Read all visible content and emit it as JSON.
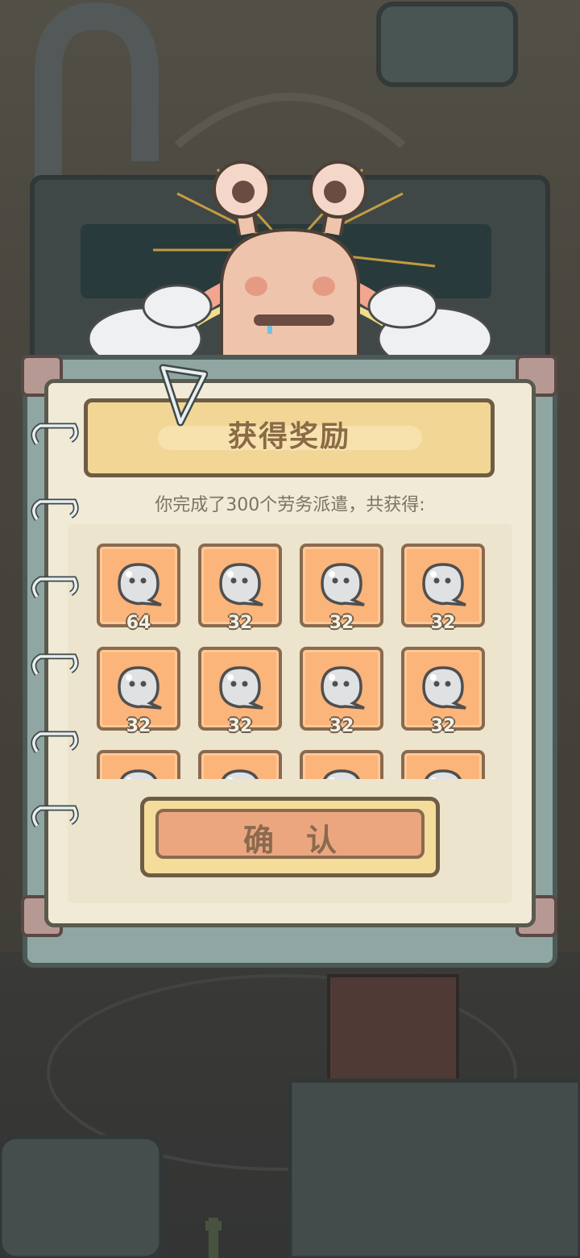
{
  "reward_dialog": {
    "title": "获得奖励",
    "subtitle": "你完成了300个劳务派遣，共获得:",
    "items": [
      {
        "icon": "ghost-icon",
        "count": "64"
      },
      {
        "icon": "ghost-icon",
        "count": "32"
      },
      {
        "icon": "ghost-icon",
        "count": "32"
      },
      {
        "icon": "ghost-icon",
        "count": "32"
      },
      {
        "icon": "ghost-icon",
        "count": "32"
      },
      {
        "icon": "ghost-icon",
        "count": "32"
      },
      {
        "icon": "ghost-icon",
        "count": "32"
      },
      {
        "icon": "ghost-icon",
        "count": "32"
      },
      {
        "icon": "ghost-icon",
        "count": ""
      },
      {
        "icon": "ghost-icon",
        "count": ""
      },
      {
        "icon": "ghost-icon",
        "count": ""
      },
      {
        "icon": "ghost-icon",
        "count": ""
      }
    ],
    "confirm_label": "确认"
  },
  "colors": {
    "tile": "#fbb47a",
    "banner": "#f2d696",
    "paper": "#f1ead6",
    "button": "#eba680",
    "frame": "#8fa6a2"
  }
}
